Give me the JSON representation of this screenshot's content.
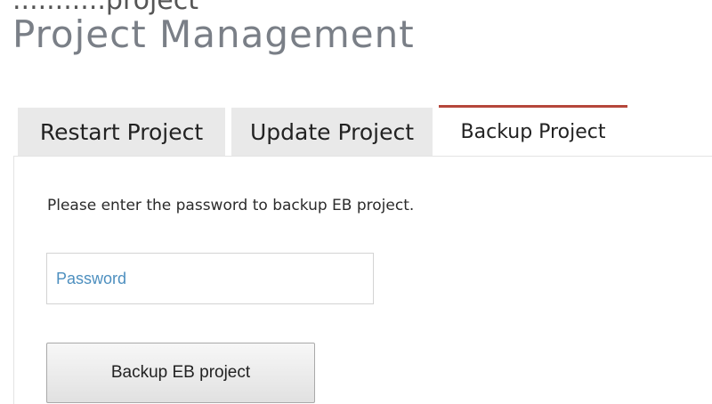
{
  "header": {
    "cropped_text": "...........project",
    "title": "Project Management"
  },
  "tabs": [
    {
      "label": "Restart Project",
      "active": false
    },
    {
      "label": "Update Project",
      "active": false
    },
    {
      "label": "Backup Project",
      "active": true
    }
  ],
  "backup_panel": {
    "instruction": "Please enter the password to backup EB project.",
    "password_placeholder": "Password",
    "password_value": "",
    "submit_label": "Backup EB project"
  },
  "colors": {
    "active_tab_accent": "#b5473b",
    "inactive_tab_bg": "#e9e9e9",
    "title_text": "#7a7f87",
    "placeholder_text": "#4d8fbf"
  }
}
